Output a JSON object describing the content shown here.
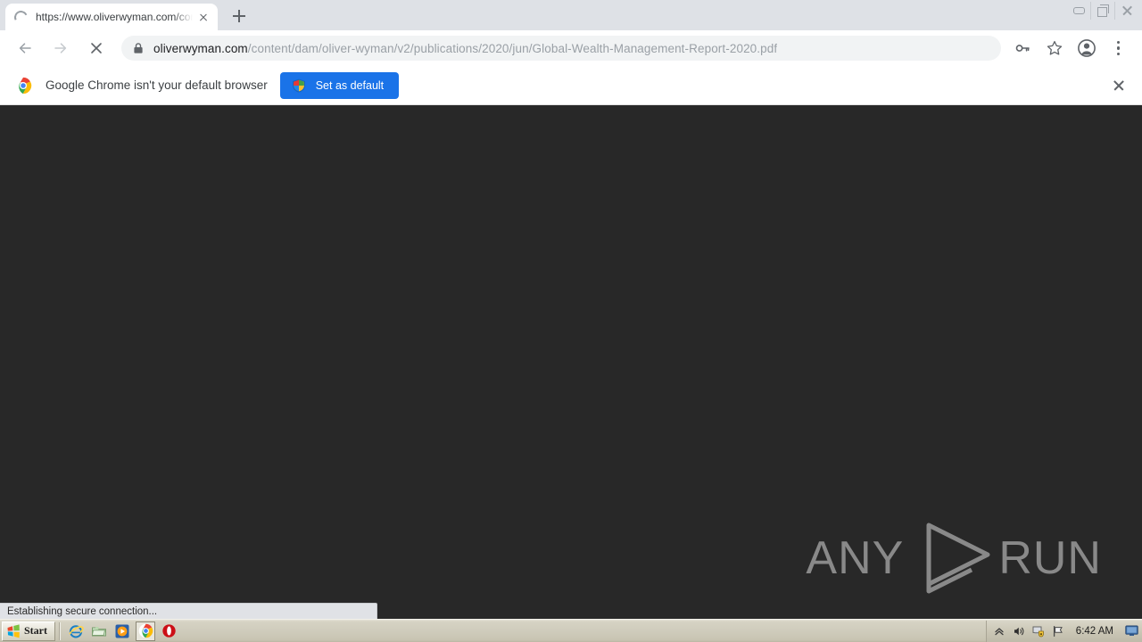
{
  "window": {
    "controls": [
      {
        "name": "minimize",
        "label": "Minimize"
      },
      {
        "name": "restore",
        "label": "Restore"
      },
      {
        "name": "close",
        "label": "Close"
      }
    ]
  },
  "tabstrip": {
    "tabs": [
      {
        "title": "https://www.oliverwyman.com/cont",
        "loading": true,
        "favicon": "loading-spinner-icon",
        "close_label": "Close tab"
      }
    ],
    "new_tab_label": "New tab",
    "new_tab_icon": "plus-icon"
  },
  "toolbar": {
    "back_icon": "arrow-left-icon",
    "forward_icon": "arrow-right-icon",
    "stop_icon": "close-x-icon",
    "security_icon": "lock-icon",
    "url_domain": "oliverwyman.com",
    "url_path": "/content/dam/oliver-wyman/v2/publications/2020/jun/Global-Wealth-Management-Report-2020.pdf",
    "url_full": "oliverwyman.com/content/dam/oliver-wyman/v2/publications/2020/jun/Global-Wealth-Management-Report-2020.pdf",
    "password_icon": "key-icon",
    "bookmark_icon": "star-icon",
    "profile_icon": "account-avatar-icon",
    "menu_icon": "three-dot-menu-icon"
  },
  "infobar": {
    "brand_icon": "chrome-logo-icon",
    "message": "Google Chrome isn't your default browser",
    "button_label": "Set as default",
    "button_icon": "windows-shield-icon",
    "button_color": "#1a73e8",
    "close_icon": "close-x-icon"
  },
  "content": {
    "background_color": "#282828",
    "watermark": {
      "text_left": "ANY",
      "text_right": "RUN",
      "logo": "play-triangle-icon",
      "color": "#898989"
    }
  },
  "status": {
    "text": "Establishing secure connection..."
  },
  "taskbar": {
    "start_label": "Start",
    "quick_launch": [
      {
        "name": "internet-explorer",
        "icon": "internet-explorer-icon"
      },
      {
        "name": "file-explorer",
        "icon": "folder-icon"
      },
      {
        "name": "media-player",
        "icon": "media-player-icon"
      },
      {
        "name": "google-chrome",
        "icon": "chrome-logo-icon",
        "active": true
      },
      {
        "name": "opera-browser",
        "icon": "red-circle-icon"
      }
    ],
    "tray": {
      "expand_icon": "chevron-up-icon",
      "volume_icon": "speaker-icon",
      "network_icon": "network-shield-icon",
      "flag_icon": "flag-icon",
      "time": "6:42 AM",
      "display_icon": "monitor-icon"
    }
  }
}
